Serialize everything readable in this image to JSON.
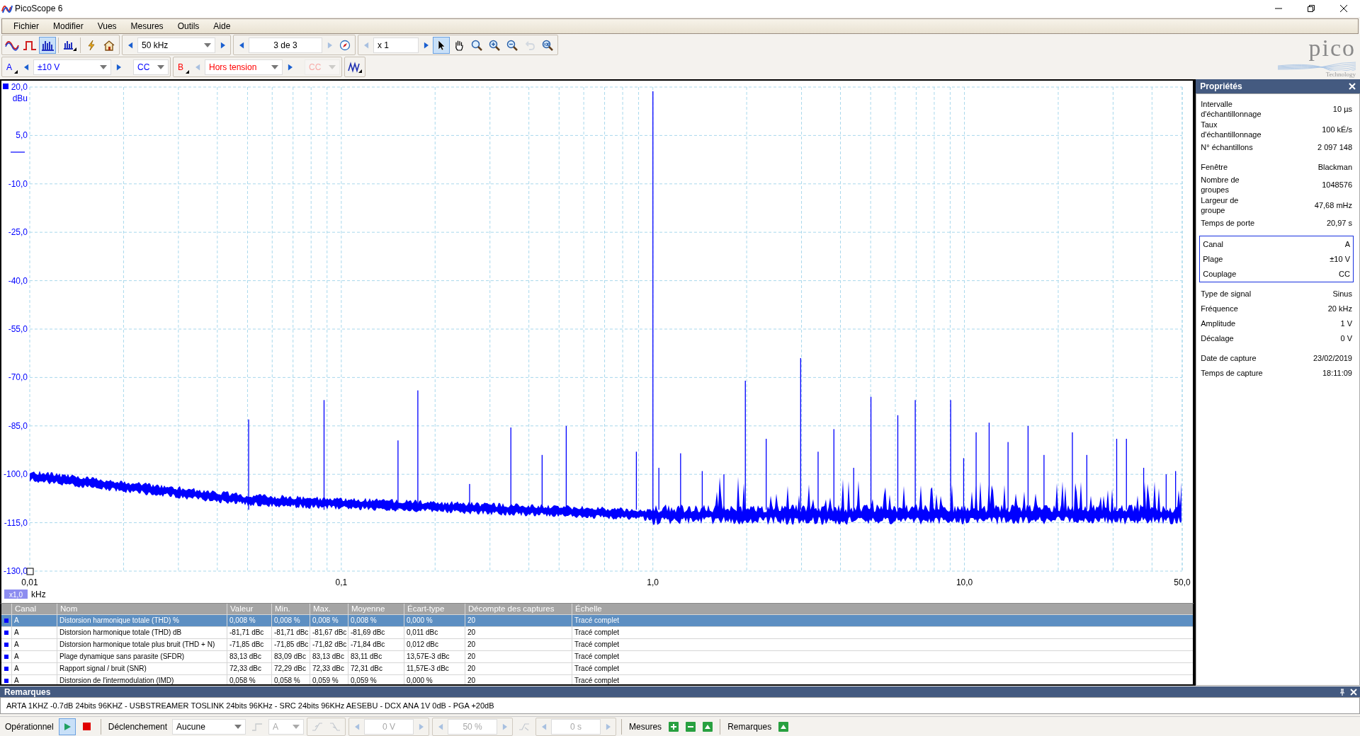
{
  "window": {
    "title": "PicoScope 6"
  },
  "menu": [
    "Fichier",
    "Modifier",
    "Vues",
    "Mesures",
    "Outils",
    "Aide"
  ],
  "toolbar": {
    "modes": [
      {
        "kind": "scope",
        "selected": false
      },
      {
        "kind": "persistence",
        "selected": false
      },
      {
        "kind": "spectrum",
        "selected": true
      }
    ],
    "timebase": "50 kHz",
    "capture": {
      "value": "3 de 3",
      "prev_disabled": false,
      "next_disabled": true
    },
    "zoom": {
      "value": "x 1",
      "prev_disabled": true,
      "next_disabled": false
    },
    "tools": [
      {
        "kind": "pointer",
        "selected": true,
        "disabled": false
      },
      {
        "kind": "hand",
        "selected": false,
        "disabled": false
      },
      {
        "kind": "zoom-fit",
        "selected": false,
        "disabled": false
      },
      {
        "kind": "zoom-in",
        "selected": false,
        "disabled": false
      },
      {
        "kind": "zoom-out",
        "selected": false,
        "disabled": false
      },
      {
        "kind": "undo",
        "selected": false,
        "disabled": true
      },
      {
        "kind": "zoom-100",
        "selected": false,
        "disabled": false
      }
    ]
  },
  "channels": [
    {
      "label": "A",
      "color": "#0000ff",
      "range": "±10 V",
      "range_prev_disabled": false,
      "coupling": "CC",
      "coupling_disabled": false
    },
    {
      "label": "B",
      "color": "#ff0000",
      "range": "Hors tension",
      "range_prev_disabled": true,
      "coupling": "CC",
      "coupling_disabled": true
    }
  ],
  "logo": {
    "name": "pico",
    "tagline": "Technology"
  },
  "chart": {
    "y_unit": "dBu",
    "y_ticks": [
      "20,0",
      "5,0",
      "-10,0",
      "-25,0",
      "-40,0",
      "-55,0",
      "-70,0",
      "-85,0",
      "-100,0",
      "-115,0",
      "-130,0"
    ],
    "x_ticks": [
      "0,01",
      "0,1",
      "1,0",
      "10,0",
      "50,0"
    ],
    "x_scale": "x1,0",
    "x_unit": "kHz"
  },
  "measurements": {
    "columns": [
      "Canal",
      "Nom",
      "Valeur",
      "Min.",
      "Max.",
      "Moyenne",
      "Écart-type",
      "Décompte des captures",
      "Échelle"
    ],
    "rows": [
      {
        "selected": true,
        "cells": [
          "A",
          "Distorsion harmonique totale (THD) %",
          "0,008 %",
          "0,008 %",
          "0,008 %",
          "0,008 %",
          "0,000 %",
          "20",
          "Tracé complet"
        ]
      },
      {
        "selected": false,
        "cells": [
          "A",
          "Distorsion harmonique totale (THD) dB",
          "-81,71 dBc",
          "-81,71 dBc",
          "-81,67 dBc",
          "-81,69 dBc",
          "0,011 dBc",
          "20",
          "Tracé complet"
        ]
      },
      {
        "selected": false,
        "cells": [
          "A",
          "Distorsion harmonique totale plus bruit (THD + N)",
          "-71,85 dBc",
          "-71,85 dBc",
          "-71,82 dBc",
          "-71,84 dBc",
          "0,012 dBc",
          "20",
          "Tracé complet"
        ]
      },
      {
        "selected": false,
        "cells": [
          "A",
          "Plage dynamique sans parasite (SFDR)",
          "83,13 dBc",
          "83,09 dBc",
          "83,13 dBc",
          "83,11 dBc",
          "13,57E-3 dBc",
          "20",
          "Tracé complet"
        ]
      },
      {
        "selected": false,
        "cells": [
          "A",
          "Rapport signal / bruit (SNR)",
          "72,33 dBc",
          "72,29 dBc",
          "72,33 dBc",
          "72,31 dBc",
          "11,57E-3 dBc",
          "20",
          "Tracé complet"
        ]
      },
      {
        "selected": false,
        "cells": [
          "A",
          "Distorsion de l'intermodulation (IMD)",
          "0,058 %",
          "0,058 %",
          "0,059 %",
          "0,059 %",
          "0,000 %",
          "20",
          "Tracé complet"
        ]
      }
    ]
  },
  "properties": {
    "title": "Propriétés",
    "groups": [
      {
        "kind": "plain",
        "items": [
          {
            "label": "Intervalle\nd'échantillonnage",
            "value": "10 µs"
          },
          {
            "label": "Taux\nd'échantillonnage",
            "value": "100 kÉ/s"
          },
          {
            "label": "N° échantillons",
            "value": "2 097 148"
          }
        ]
      },
      {
        "kind": "plain",
        "items": [
          {
            "label": "Fenêtre",
            "value": "Blackman"
          },
          {
            "label": "Nombre de\ngroupes",
            "value": "1048576"
          },
          {
            "label": "Largeur de\ngroupe",
            "value": "47,68 mHz"
          },
          {
            "label": "Temps de porte",
            "value": "20,97 s"
          }
        ]
      },
      {
        "kind": "boxed",
        "items": [
          {
            "label": "Canal",
            "value": "A"
          },
          {
            "label": "Plage",
            "value": "±10 V"
          },
          {
            "label": "Couplage",
            "value": "CC"
          }
        ]
      },
      {
        "kind": "plain",
        "items": [
          {
            "label": "Type de signal",
            "value": "Sinus"
          },
          {
            "label": "Fréquence",
            "value": "20 kHz"
          },
          {
            "label": "Amplitude",
            "value": "1 V"
          },
          {
            "label": "Décalage",
            "value": "0 V"
          }
        ]
      },
      {
        "kind": "plain",
        "items": [
          {
            "label": "Date de capture",
            "value": "23/02/2019"
          },
          {
            "label": "Temps de capture",
            "value": "18:11:09"
          }
        ]
      }
    ]
  },
  "remarks": {
    "title": "Remarques",
    "text": "ARTA 1KHZ -0.7dB 24bits 96KHZ - USBSTREAMER TOSLINK 24bits 96KHz - SRC 24bits 96KHz AESEBU - DCX ANA 1V 0dB - PGA +20dB"
  },
  "status_bar": {
    "state": "Opérationnel",
    "running": true,
    "trigger_label": "Déclenchement",
    "trigger_mode": "Aucune",
    "trigger_channel": {
      "value": "A",
      "disabled": true
    },
    "threshold": {
      "value": "0 V",
      "disabled": true
    },
    "pretrigger": {
      "value": "50 %",
      "disabled": true
    },
    "delay": {
      "value": "0 s",
      "disabled": true
    },
    "measures_label": "Mesures",
    "remarks_label": "Remarques"
  }
}
